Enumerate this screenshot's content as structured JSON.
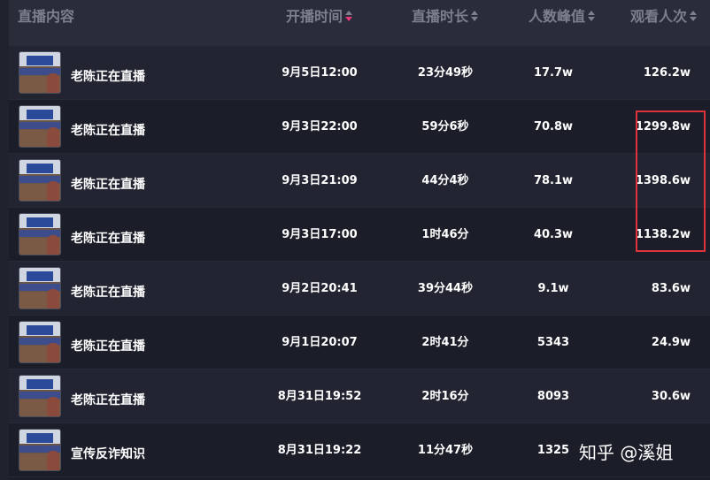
{
  "header": {
    "content_label": "直播内容",
    "start_time_label": "开播时间",
    "duration_label": "直播时长",
    "peak_label": "人数峰值",
    "views_label": "观看人次",
    "active_sort": "开播时间",
    "active_sort_color": "#e8387a"
  },
  "rows": [
    {
      "title": "老陈正在直播",
      "start_time": "9月5日12:00",
      "duration": "23分49秒",
      "peak": "17.7w",
      "views": "126.2w"
    },
    {
      "title": "老陈正在直播",
      "start_time": "9月3日22:00",
      "duration": "59分6秒",
      "peak": "70.8w",
      "views": "1299.8w"
    },
    {
      "title": "老陈正在直播",
      "start_time": "9月3日21:09",
      "duration": "44分4秒",
      "peak": "78.1w",
      "views": "1398.6w"
    },
    {
      "title": "老陈正在直播",
      "start_time": "9月3日17:00",
      "duration": "1时46分",
      "peak": "40.3w",
      "views": "1138.2w"
    },
    {
      "title": "老陈正在直播",
      "start_time": "9月2日20:41",
      "duration": "39分44秒",
      "peak": "9.1w",
      "views": "83.6w"
    },
    {
      "title": "老陈正在直播",
      "start_time": "9月1日20:07",
      "duration": "2时41分",
      "peak": "5343",
      "views": "24.9w"
    },
    {
      "title": "老陈正在直播",
      "start_time": "8月31日19:52",
      "duration": "2时16分",
      "peak": "8093",
      "views": "30.6w"
    },
    {
      "title": "宣传反诈知识",
      "start_time": "8月31日19:22",
      "duration": "11分47秒",
      "peak": "1325",
      "views": ""
    }
  ],
  "highlight_color": "#e0323c",
  "watermark": "知乎 @溪姐"
}
